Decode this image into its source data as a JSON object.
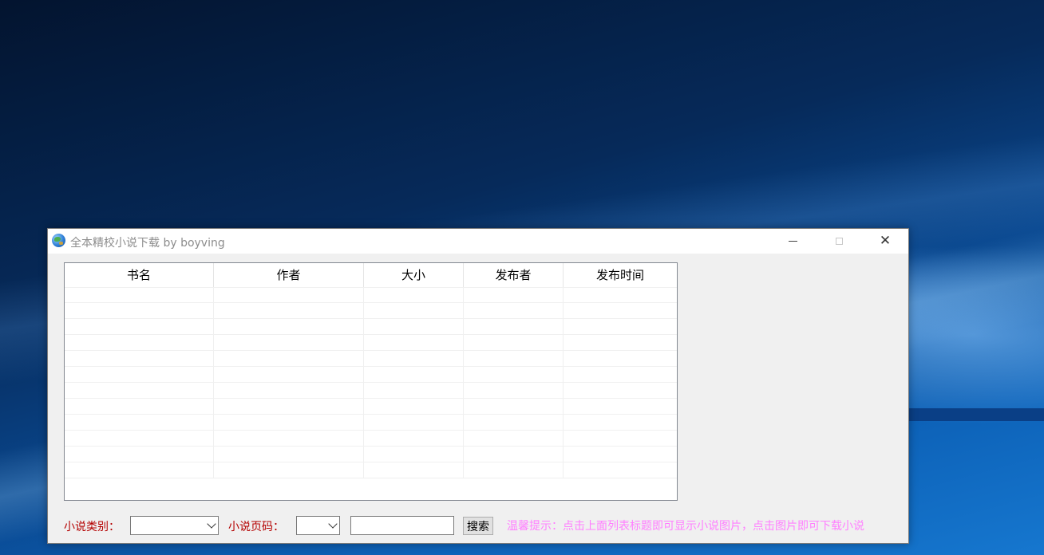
{
  "window": {
    "title": "全本精校小说下载 by boyving",
    "icon": "globe-icon"
  },
  "listview": {
    "columns": [
      "书名",
      "作者",
      "大小",
      "发布者",
      "发布时间"
    ],
    "rows": 12
  },
  "controls": {
    "category_label": "小说类别：",
    "category_value": "",
    "page_label": "小说页码：",
    "page_value": "",
    "search_text": "",
    "search_button": "搜索"
  },
  "hint": "温馨提示：点击上面列表标题即可显示小说图片，点击图片即可下载小说",
  "colors": {
    "label": "#b40000",
    "hint": "#ff7fff"
  }
}
